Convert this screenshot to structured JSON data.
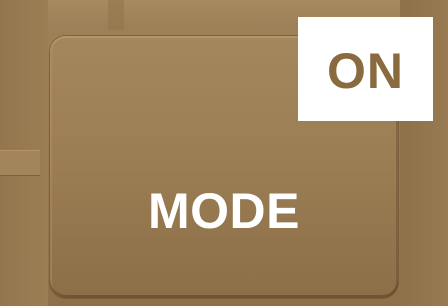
{
  "button": {
    "label": "MODE",
    "state_label": "ON"
  },
  "colors": {
    "background": "#987a52",
    "button_face": "#9a7c53",
    "label_text": "#ffffff",
    "badge_background": "#ffffff",
    "badge_text": "#8a6a3f"
  }
}
